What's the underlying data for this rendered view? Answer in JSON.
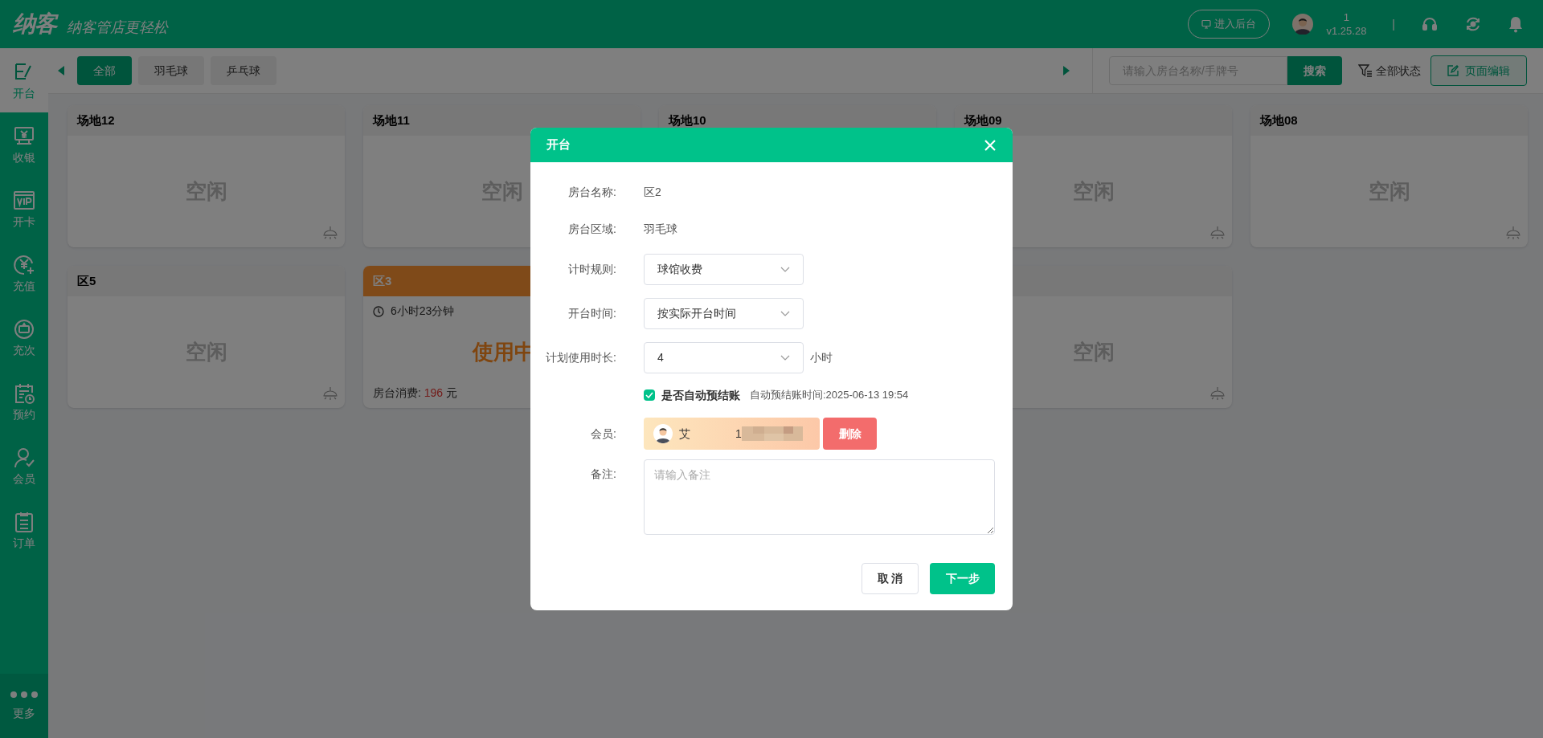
{
  "header": {
    "logo": "纳客",
    "slogan": "纳客管店更轻松",
    "backend_button": "进入后台",
    "user": {
      "name": "1",
      "version": "v1.25.28"
    },
    "separator": "|"
  },
  "sidebar": {
    "items": [
      {
        "label": "开台",
        "selected": true
      },
      {
        "label": "收银",
        "selected": false
      },
      {
        "label": "开卡",
        "selected": false
      },
      {
        "label": "充值",
        "selected": false
      },
      {
        "label": "充次",
        "selected": false
      },
      {
        "label": "预约",
        "selected": false
      },
      {
        "label": "会员",
        "selected": false
      },
      {
        "label": "订单",
        "selected": false
      }
    ],
    "more": "更多"
  },
  "filter_bar": {
    "tabs": [
      {
        "label": "全部",
        "selected": true
      },
      {
        "label": "羽毛球",
        "selected": false
      },
      {
        "label": "乒乓球",
        "selected": false
      }
    ],
    "search": {
      "placeholder": "请输入房台名称/手牌号",
      "button": "搜索"
    },
    "status_filter": "全部状态",
    "edit_button": "页面编辑"
  },
  "cards": [
    {
      "kind": "idle",
      "title": "场地12",
      "status": "空闲"
    },
    {
      "kind": "idle",
      "title": "场地11",
      "status": "空闲"
    },
    {
      "kind": "idle",
      "title": "场地10"
    },
    {
      "kind": "idle",
      "title": "场地09",
      "status": "空闲"
    },
    {
      "kind": "idle",
      "title": "场地08",
      "status": "空闲"
    },
    {
      "kind": "idle",
      "title": "区5",
      "status": "空闲"
    },
    {
      "kind": "in_use",
      "title": "区3",
      "duration": "6小时23分钟",
      "status": "使用中",
      "consumption_label": "房台消费:",
      "amount": "196",
      "unit": "元"
    },
    {
      "kind": "hidden"
    },
    {
      "kind": "idle",
      "status": "空闲"
    }
  ],
  "dialog": {
    "title": "开台",
    "fields": [
      {
        "kind": "text",
        "label": "房台名称:",
        "value": "区2"
      },
      {
        "kind": "text",
        "label": "房台区域:",
        "value": "羽毛球"
      },
      {
        "kind": "select",
        "label": "计时规则:",
        "value": "球馆收费"
      },
      {
        "kind": "select",
        "label": "开台时间:",
        "value": "按实际开台时间"
      },
      {
        "kind": "select",
        "label": "计划使用时长:",
        "value": "4",
        "suffix": "小时"
      },
      {
        "kind": "checkbox",
        "label": "是否自动预结账",
        "checked": true,
        "note": "自动预结账时间:2025-06-13 19:54"
      },
      {
        "kind": "member",
        "label": "会员:",
        "name": "艾",
        "phone": "1",
        "button": "删除"
      },
      {
        "kind": "textarea",
        "label": "备注:",
        "placeholder": "请输入备注"
      }
    ],
    "buttons": [
      {
        "label": "取 消",
        "kind": "secondary"
      },
      {
        "label": "下一步",
        "kind": "primary"
      }
    ]
  }
}
